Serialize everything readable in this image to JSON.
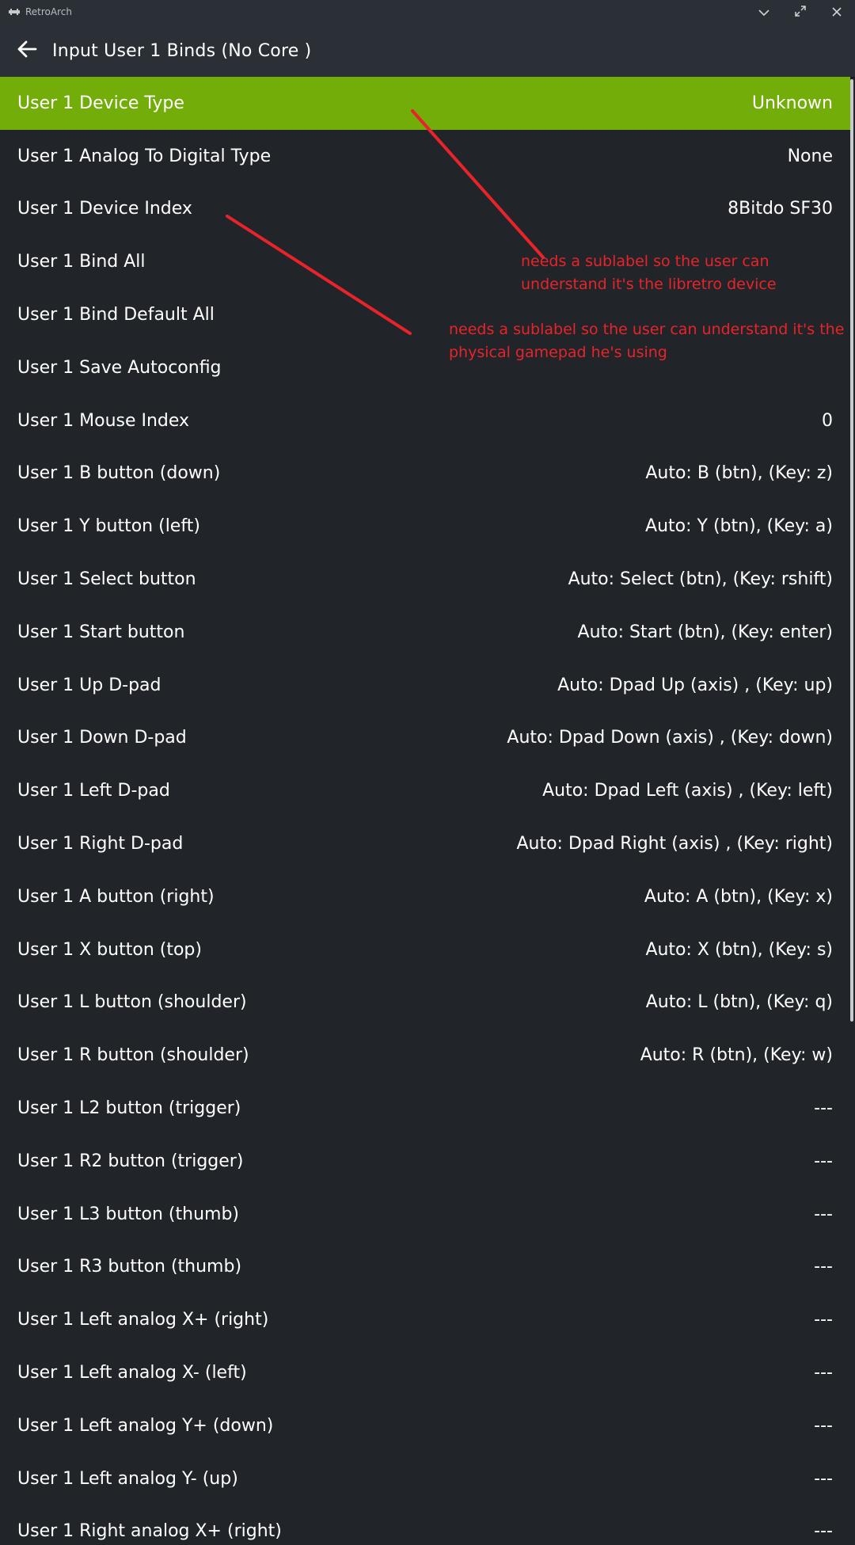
{
  "app": {
    "title": "RetroArch"
  },
  "header": {
    "title": "Input User 1 Binds (No Core )"
  },
  "icons": {
    "app": "retroarch-invader-icon",
    "minimize": "chevron-down-icon",
    "maximize": "expand-arrows-icon",
    "close": "close-icon",
    "back": "arrow-left-icon"
  },
  "colors": {
    "selected_row": "#72ad0a",
    "background": "#212529",
    "annotation": "#e8232a"
  },
  "menu": {
    "items": [
      {
        "label": "User 1 Device Type",
        "value": "Unknown",
        "selected": true
      },
      {
        "label": "User 1 Analog To Digital Type",
        "value": "None"
      },
      {
        "label": "User 1 Device Index",
        "value": "8Bitdo SF30"
      },
      {
        "label": "User 1 Bind All",
        "value": ""
      },
      {
        "label": "User 1 Bind Default All",
        "value": ""
      },
      {
        "label": "User 1 Save Autoconfig",
        "value": ""
      },
      {
        "label": "User 1 Mouse Index",
        "value": "0"
      },
      {
        "label": "User 1 B button (down)",
        "value": "Auto: B (btn), (Key: z)"
      },
      {
        "label": "User 1 Y button (left)",
        "value": "Auto: Y (btn), (Key: a)"
      },
      {
        "label": "User 1 Select button",
        "value": "Auto: Select (btn), (Key: rshift)"
      },
      {
        "label": "User 1 Start button",
        "value": "Auto: Start (btn), (Key: enter)"
      },
      {
        "label": "User 1 Up D-pad",
        "value": "Auto: Dpad Up (axis) , (Key: up)"
      },
      {
        "label": "User 1 Down D-pad",
        "value": "Auto: Dpad Down (axis) , (Key: down)"
      },
      {
        "label": "User 1 Left D-pad",
        "value": "Auto: Dpad Left (axis) , (Key: left)"
      },
      {
        "label": "User 1 Right D-pad",
        "value": "Auto: Dpad Right (axis) , (Key: right)"
      },
      {
        "label": "User 1 A button (right)",
        "value": "Auto: A (btn), (Key: x)"
      },
      {
        "label": "User 1 X button (top)",
        "value": "Auto: X (btn), (Key: s)"
      },
      {
        "label": "User 1 L button (shoulder)",
        "value": "Auto: L (btn), (Key: q)"
      },
      {
        "label": "User 1 R button (shoulder)",
        "value": "Auto: R (btn), (Key: w)"
      },
      {
        "label": "User 1 L2 button (trigger)",
        "value": "---"
      },
      {
        "label": "User 1 R2 button (trigger)",
        "value": "---"
      },
      {
        "label": "User 1 L3 button (thumb)",
        "value": "---"
      },
      {
        "label": "User 1 R3 button (thumb)",
        "value": "---"
      },
      {
        "label": "User 1 Left analog X+ (right)",
        "value": "---"
      },
      {
        "label": "User 1 Left analog X- (left)",
        "value": "---"
      },
      {
        "label": "User 1 Left analog Y+ (down)",
        "value": "---"
      },
      {
        "label": "User 1 Left analog Y- (up)",
        "value": "---"
      },
      {
        "label": "User 1 Right analog X+ (right)",
        "value": "---"
      }
    ]
  },
  "annotations": {
    "device_type_note": "needs a sublabel so the user can understand it's the libretro device",
    "device_index_note": "needs a sublabel so the user can understand it's the physical gamepad he's using"
  }
}
